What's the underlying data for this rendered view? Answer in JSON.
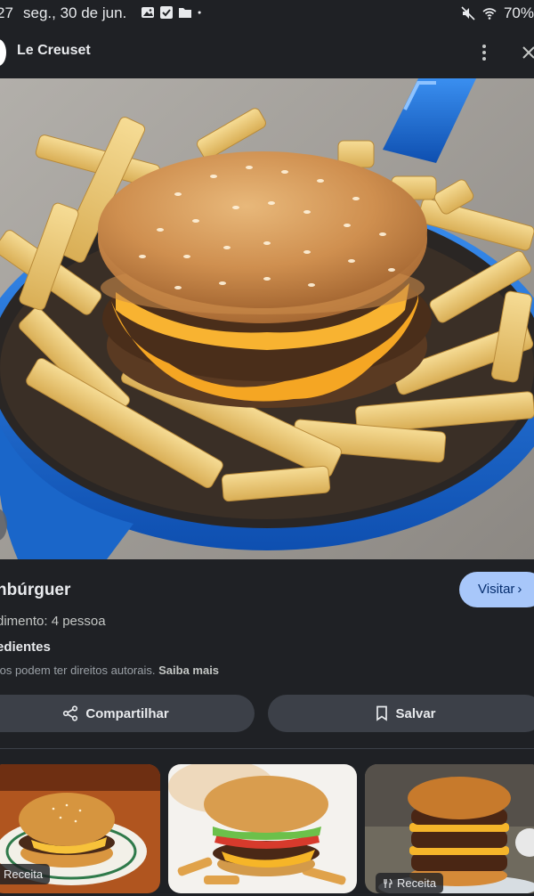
{
  "status_bar": {
    "time": "27",
    "date": "seg., 30 de jun.",
    "battery": "70%",
    "icons": [
      "image-icon",
      "checkbox-icon",
      "folder-icon",
      "dot-icon",
      "mute-icon",
      "wifi-icon"
    ]
  },
  "header": {
    "site_name": "Le Creuset",
    "more_icon": "more-vert-icon",
    "close_icon": "close-icon"
  },
  "hero": {
    "description_icon": "photo"
  },
  "recipe": {
    "title": "nbúrguer",
    "yield": "dimento: 4 pessoa",
    "ingredients_label": "edientes",
    "copyright_text": "tos podem ter direitos autorais.",
    "learn_more": "Saiba mais",
    "visit_label": "Visitar"
  },
  "actions": {
    "share_label": "Compartilhar",
    "save_label": "Salvar"
  },
  "related": {
    "cards": [
      {
        "badge": "Receita"
      },
      {
        "badge": ""
      },
      {
        "badge": "Receita"
      }
    ]
  },
  "colors": {
    "background": "#1f2125",
    "visit_button": "#a8c7fa",
    "pill_button": "#3c4048",
    "pan_blue": "#1a66c9"
  }
}
